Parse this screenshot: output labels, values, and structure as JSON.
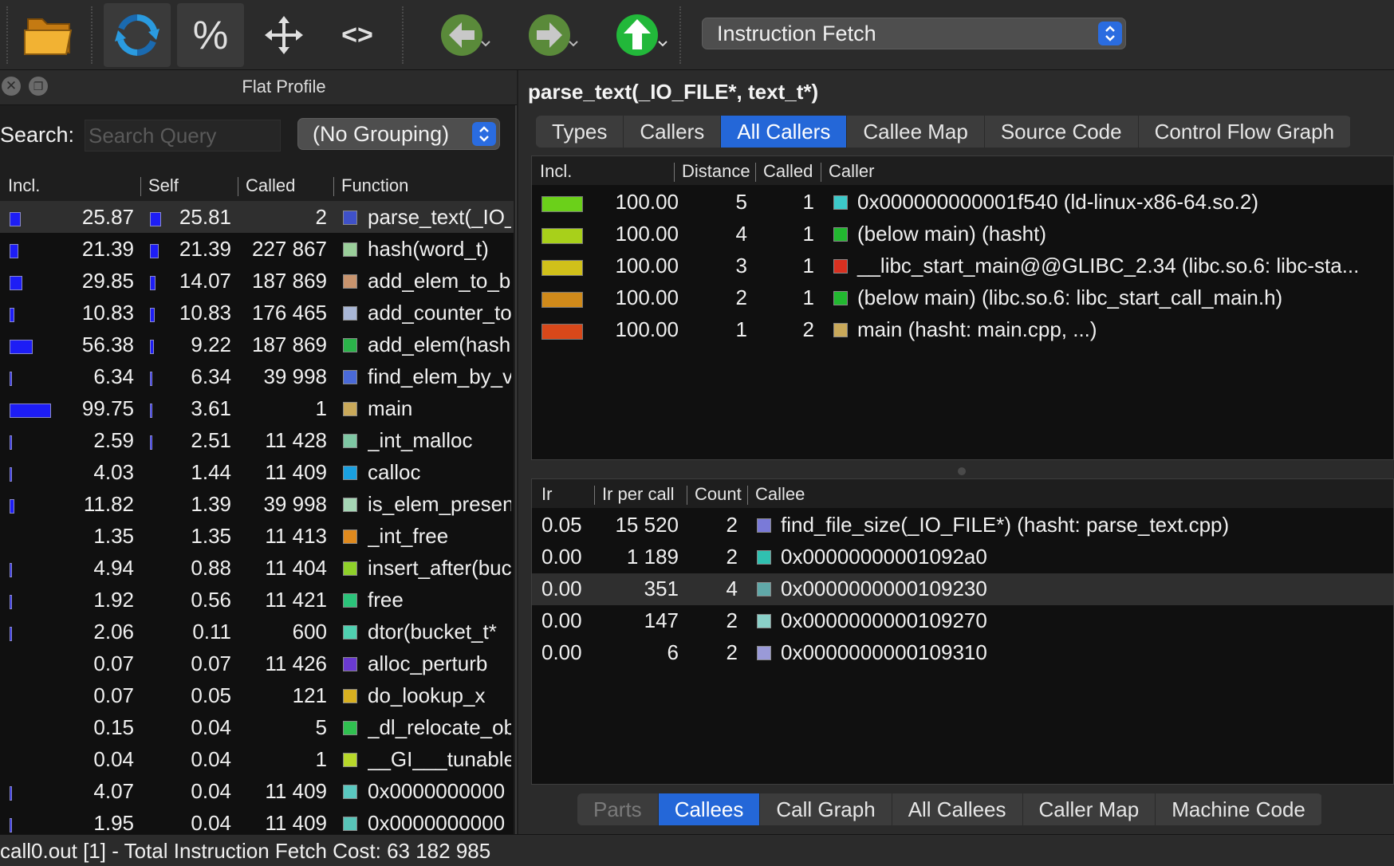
{
  "toolbar": {
    "buttons": [
      {
        "name": "open",
        "icon": "folder-icon"
      },
      {
        "name": "reload",
        "icon": "reload-icon"
      },
      {
        "name": "relative",
        "icon": "percent-icon",
        "label": "%"
      },
      {
        "name": "cycle",
        "icon": "move-icon"
      },
      {
        "name": "shorten",
        "icon": "code-brackets-icon",
        "label": "<>"
      },
      {
        "name": "back",
        "icon": "arrow-left-icon"
      },
      {
        "name": "forward",
        "icon": "arrow-right-icon"
      },
      {
        "name": "up",
        "icon": "arrow-up-icon"
      }
    ],
    "event_type": "Instruction Fetch"
  },
  "flat_profile": {
    "title": "Flat Profile",
    "search_label": "Search:",
    "search_placeholder": "Search Query",
    "grouping": "(No Grouping)",
    "columns": [
      "Incl.",
      "Self",
      "Called",
      "Function"
    ],
    "rows": [
      {
        "incl": "25.87",
        "self": "25.81",
        "called": "2",
        "func": "parse_text(_IO_FILE*, text_t*)",
        "color": "#3f51c8",
        "incl_frac": 0.26,
        "self_frac": 0.26,
        "selected": true
      },
      {
        "incl": "21.39",
        "self": "21.39",
        "called": "227 867",
        "func": "hash(word_t)",
        "color": "#9bcf9b",
        "incl_frac": 0.21,
        "self_frac": 0.21
      },
      {
        "incl": "29.85",
        "self": "14.07",
        "called": "187 869",
        "func": "add_elem_to_bucket",
        "color": "#c8946e",
        "incl_frac": 0.3,
        "self_frac": 0.14
      },
      {
        "incl": "10.83",
        "self": "10.83",
        "called": "176 465",
        "func": "add_counter_to",
        "color": "#a9b7d6",
        "incl_frac": 0.11,
        "self_frac": 0.11
      },
      {
        "incl": "56.38",
        "self": "9.22",
        "called": "187 869",
        "func": "add_elem(hash",
        "color": "#2bb34a",
        "incl_frac": 0.56,
        "self_frac": 0.09
      },
      {
        "incl": "6.34",
        "self": "6.34",
        "called": "39 998",
        "func": "find_elem_by_v",
        "color": "#4a6ad8",
        "incl_frac": 0.06,
        "self_frac": 0.06
      },
      {
        "incl": "99.75",
        "self": "3.61",
        "called": "1",
        "func": "main",
        "color": "#c9a95a",
        "incl_frac": 1.0,
        "self_frac": 0.04
      },
      {
        "incl": "2.59",
        "self": "2.51",
        "called": "11 428",
        "func": "_int_malloc",
        "color": "#7fc7a4",
        "incl_frac": 0.03,
        "self_frac": 0.03
      },
      {
        "incl": "4.03",
        "self": "1.44",
        "called": "11 409",
        "func": "calloc",
        "color": "#1aa0e0",
        "incl_frac": 0.04,
        "self_frac": 0.01
      },
      {
        "incl": "11.82",
        "self": "1.39",
        "called": "39 998",
        "func": "is_elem_present",
        "color": "#a5d6b5",
        "incl_frac": 0.12,
        "self_frac": 0.01
      },
      {
        "incl": "1.35",
        "self": "1.35",
        "called": "11 413",
        "func": "_int_free",
        "color": "#e08a1e",
        "incl_frac": 0.01,
        "self_frac": 0.01
      },
      {
        "incl": "4.94",
        "self": "0.88",
        "called": "11 404",
        "func": "insert_after(bucket",
        "color": "#8fd02a",
        "incl_frac": 0.05,
        "self_frac": 0.01
      },
      {
        "incl": "1.92",
        "self": "0.56",
        "called": "11 421",
        "func": "free",
        "color": "#2bc37a",
        "incl_frac": 0.02,
        "self_frac": 0.01
      },
      {
        "incl": "2.06",
        "self": "0.11",
        "called": "600",
        "func": "dtor(bucket_t*",
        "color": "#4fd0b0",
        "incl_frac": 0.02,
        "self_frac": 0.0
      },
      {
        "incl": "0.07",
        "self": "0.07",
        "called": "11 426",
        "func": "alloc_perturb",
        "color": "#6a3ad0",
        "incl_frac": 0.0,
        "self_frac": 0.0
      },
      {
        "incl": "0.07",
        "self": "0.05",
        "called": "121",
        "func": "do_lookup_x",
        "color": "#d8b020",
        "incl_frac": 0.0,
        "self_frac": 0.0
      },
      {
        "incl": "0.15",
        "self": "0.04",
        "called": "5",
        "func": "_dl_relocate_object",
        "color": "#30c050",
        "incl_frac": 0.0,
        "self_frac": 0.0
      },
      {
        "incl": "0.04",
        "self": "0.04",
        "called": "1",
        "func": "__GI___tunables",
        "color": "#b8d82a",
        "incl_frac": 0.0,
        "self_frac": 0.0
      },
      {
        "incl": "4.07",
        "self": "0.04",
        "called": "11 409",
        "func": "0x0000000000",
        "color": "#5ac8c0",
        "incl_frac": 0.04,
        "self_frac": 0.0
      },
      {
        "incl": "1.95",
        "self": "0.04",
        "called": "11 409",
        "func": "0x0000000000",
        "color": "#58c4b8",
        "incl_frac": 0.02,
        "self_frac": 0.0
      }
    ]
  },
  "detail": {
    "function_title": "parse_text(_IO_FILE*, text_t*)",
    "top_tabs": [
      "Types",
      "Callers",
      "All Callers",
      "Callee Map",
      "Source Code",
      "Control Flow Graph"
    ],
    "top_active": 2,
    "callers_columns": [
      "Incl.",
      "Distance",
      "Called",
      "Caller"
    ],
    "callers": [
      {
        "bar_color": "#6bd01a",
        "incl": "100.00",
        "distance": "5",
        "called": "1",
        "caller": "0x000000000001f540 (ld-linux-x86-64.so.2)",
        "color": "#3cc8c8"
      },
      {
        "bar_color": "#a8d01a",
        "incl": "100.00",
        "distance": "4",
        "called": "1",
        "caller": "(below main) (hasht)",
        "color": "#22b830"
      },
      {
        "bar_color": "#d0c01a",
        "incl": "100.00",
        "distance": "3",
        "called": "1",
        "caller": "__libc_start_main@@GLIBC_2.34 (libc.so.6: libc-sta...",
        "color": "#d83020"
      },
      {
        "bar_color": "#d08a1a",
        "incl": "100.00",
        "distance": "2",
        "called": "1",
        "caller": "(below main) (libc.so.6: libc_start_call_main.h)",
        "color": "#22b830"
      },
      {
        "bar_color": "#d8481a",
        "incl": "100.00",
        "distance": "1",
        "called": "2",
        "caller": "main (hasht: main.cpp, ...)",
        "color": "#c9a95a"
      }
    ],
    "callees_columns": [
      "Ir",
      "Ir per call",
      "Count",
      "Callee"
    ],
    "callees": [
      {
        "ir": "0.05",
        "per_call": "15 520",
        "count": "2",
        "callee": "find_file_size(_IO_FILE*) (hasht: parse_text.cpp)",
        "color": "#7a7ad8"
      },
      {
        "ir": "0.00",
        "per_call": "1 189",
        "count": "2",
        "callee": "0x00000000001092a0",
        "color": "#30c0b0"
      },
      {
        "ir": "0.00",
        "per_call": "351",
        "count": "4",
        "callee": "0x0000000000109230",
        "color": "#60a8a8",
        "selected": true
      },
      {
        "ir": "0.00",
        "per_call": "147",
        "count": "2",
        "callee": "0x0000000000109270",
        "color": "#8ad0c8"
      },
      {
        "ir": "0.00",
        "per_call": "6",
        "count": "2",
        "callee": "0x0000000000109310",
        "color": "#9a9ad8"
      }
    ],
    "bottom_tabs": [
      "Parts",
      "Callees",
      "Call Graph",
      "All Callees",
      "Caller Map",
      "Machine Code"
    ],
    "bottom_active": 1,
    "bottom_disabled": 0
  },
  "status": "call0.out [1] - Total Instruction Fetch Cost: 63 182 985"
}
